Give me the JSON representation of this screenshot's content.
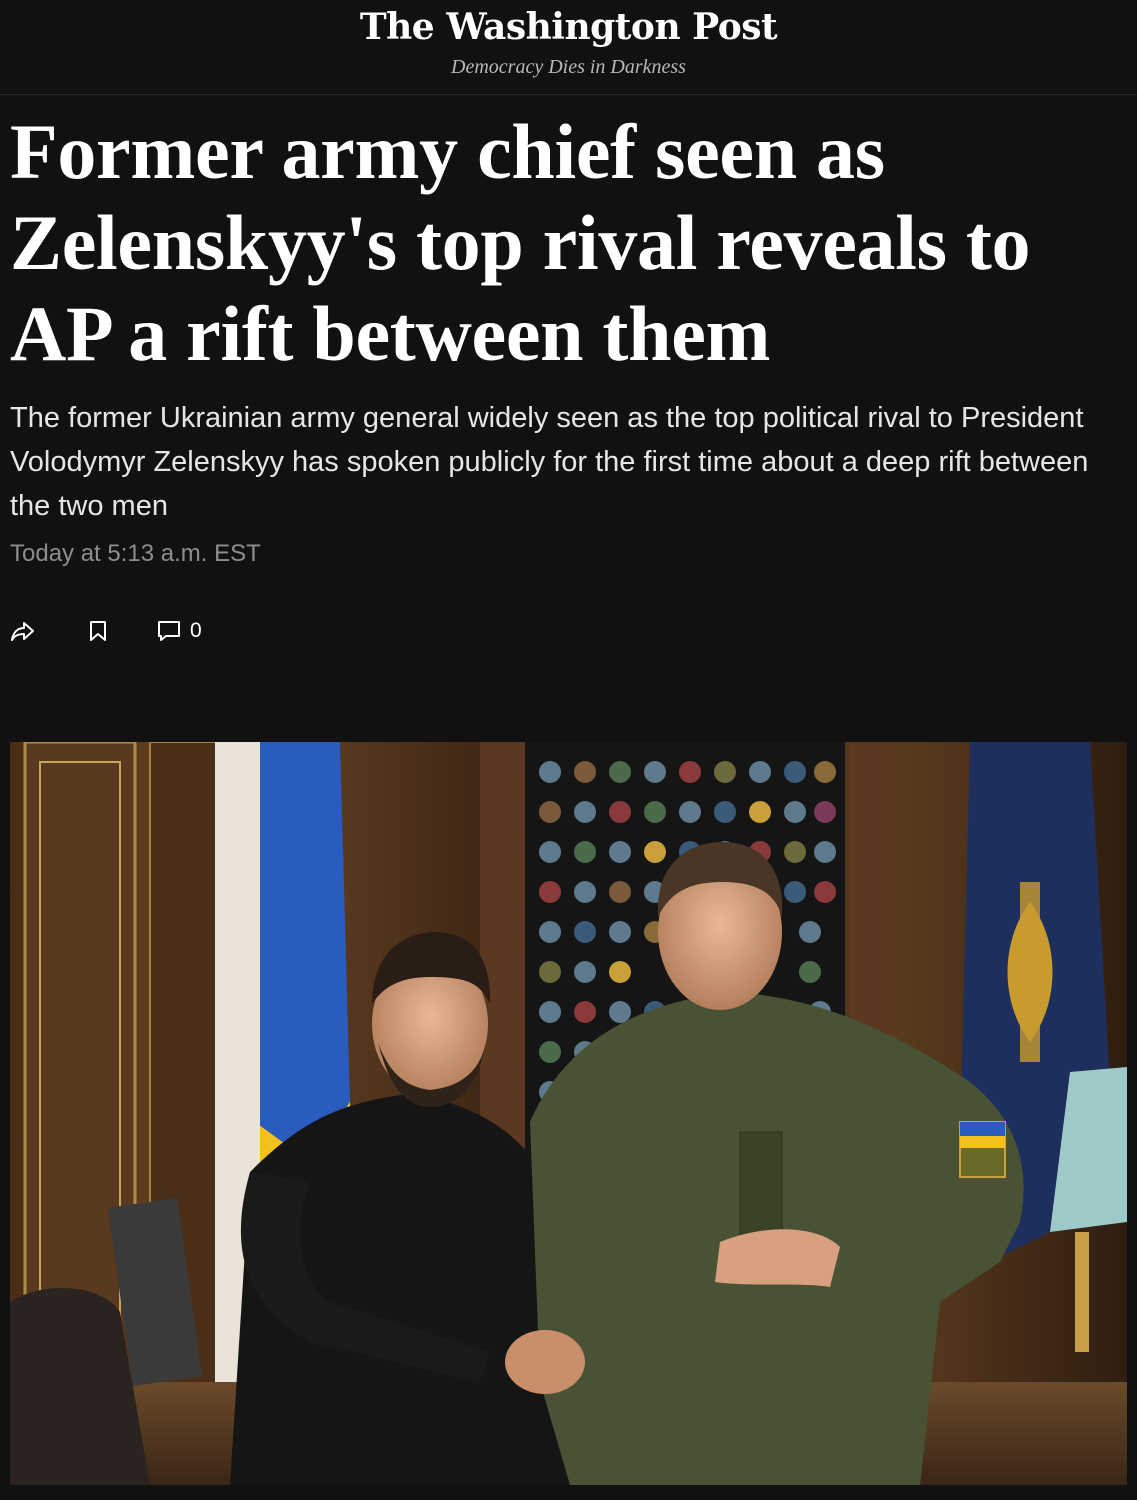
{
  "masthead": {
    "logo_text": "The Washington Post",
    "tagline": "Democracy Dies in Darkness"
  },
  "article": {
    "headline": "Former army chief seen as Zelenskyy's top rival reveals to AP a rift between them",
    "subheadline": "The former Ukrainian army general widely seen as the top political rival to President Volodymyr Zelenskyy has spoken publicly for the first time about a deep rift between the two men",
    "timestamp": "Today at 5:13 a.m. EST",
    "actions": {
      "share_icon": "share-icon",
      "save_icon": "bookmark-icon",
      "comment_icon": "comment-icon",
      "comment_count": "0"
    }
  },
  "colors": {
    "background": "#111111",
    "headline": "#ffffff",
    "subheadline": "#e6e6e6",
    "timestamp": "#8e8e8e",
    "tagline": "#b8b8b8"
  }
}
